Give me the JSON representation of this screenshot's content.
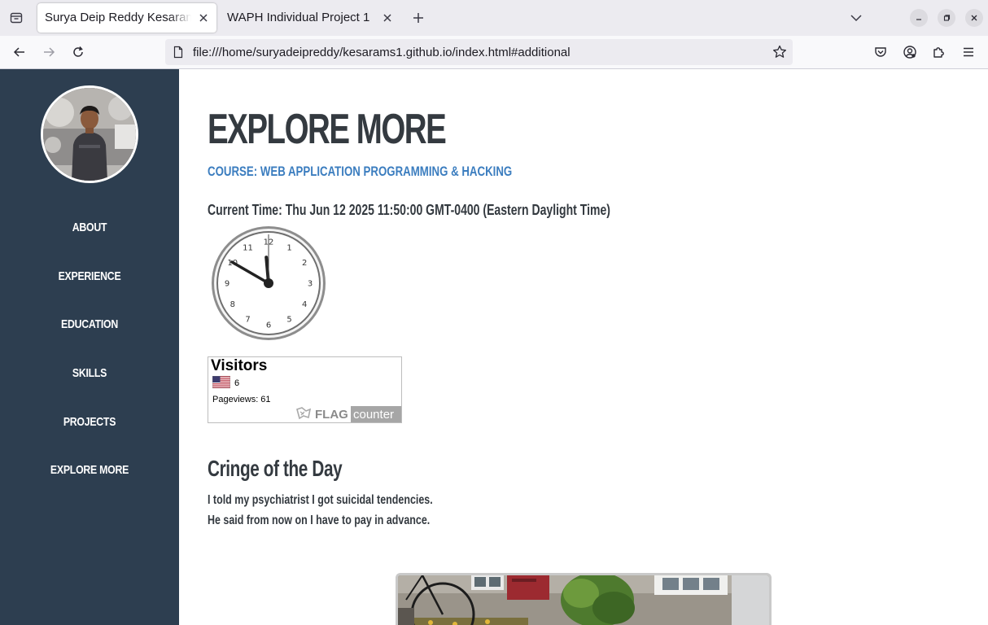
{
  "browser": {
    "tabs": [
      {
        "title": "Surya Deip Reddy Kesaram - I",
        "active": true
      },
      {
        "title": "WAPH Individual Project 1",
        "active": false
      }
    ],
    "url": "file:///home/suryadeipreddy/kesarams1.github.io/index.html#additional"
  },
  "sidebar": {
    "items": [
      {
        "label": "ABOUT"
      },
      {
        "label": "EXPERIENCE"
      },
      {
        "label": "EDUCATION"
      },
      {
        "label": "SKILLS"
      },
      {
        "label": "PROJECTS"
      },
      {
        "label": "EXPLORE MORE"
      }
    ]
  },
  "main": {
    "heading": "EXPLORE MORE",
    "course": "COURSE: WEB APPLICATION PROGRAMMING & HACKING",
    "current_time": "Current Time: Thu Jun 12 2025 11:50:00 GMT-0400 (Eastern Daylight Time)",
    "clock": {
      "numerals": [
        "12",
        "1",
        "2",
        "3",
        "4",
        "5",
        "6",
        "7",
        "8",
        "9",
        "10",
        "11"
      ],
      "hour": 11,
      "minute": 50,
      "second": 0
    },
    "visitor_counter": {
      "title": "Visitors",
      "country_count": "6",
      "pageviews": "Pageviews:  61",
      "logo_flag": "FLAG",
      "logo_counter": "counter"
    },
    "cringe": {
      "title": "Cringe of the Day",
      "line1": "I told my psychiatrist I got suicidal tendencies.",
      "line2": "He said from now on I have to pay in advance."
    }
  },
  "colors": {
    "sidebar_bg": "#2d3e50",
    "accent_blue": "#3b7dbf",
    "heading_text": "#343a40"
  }
}
